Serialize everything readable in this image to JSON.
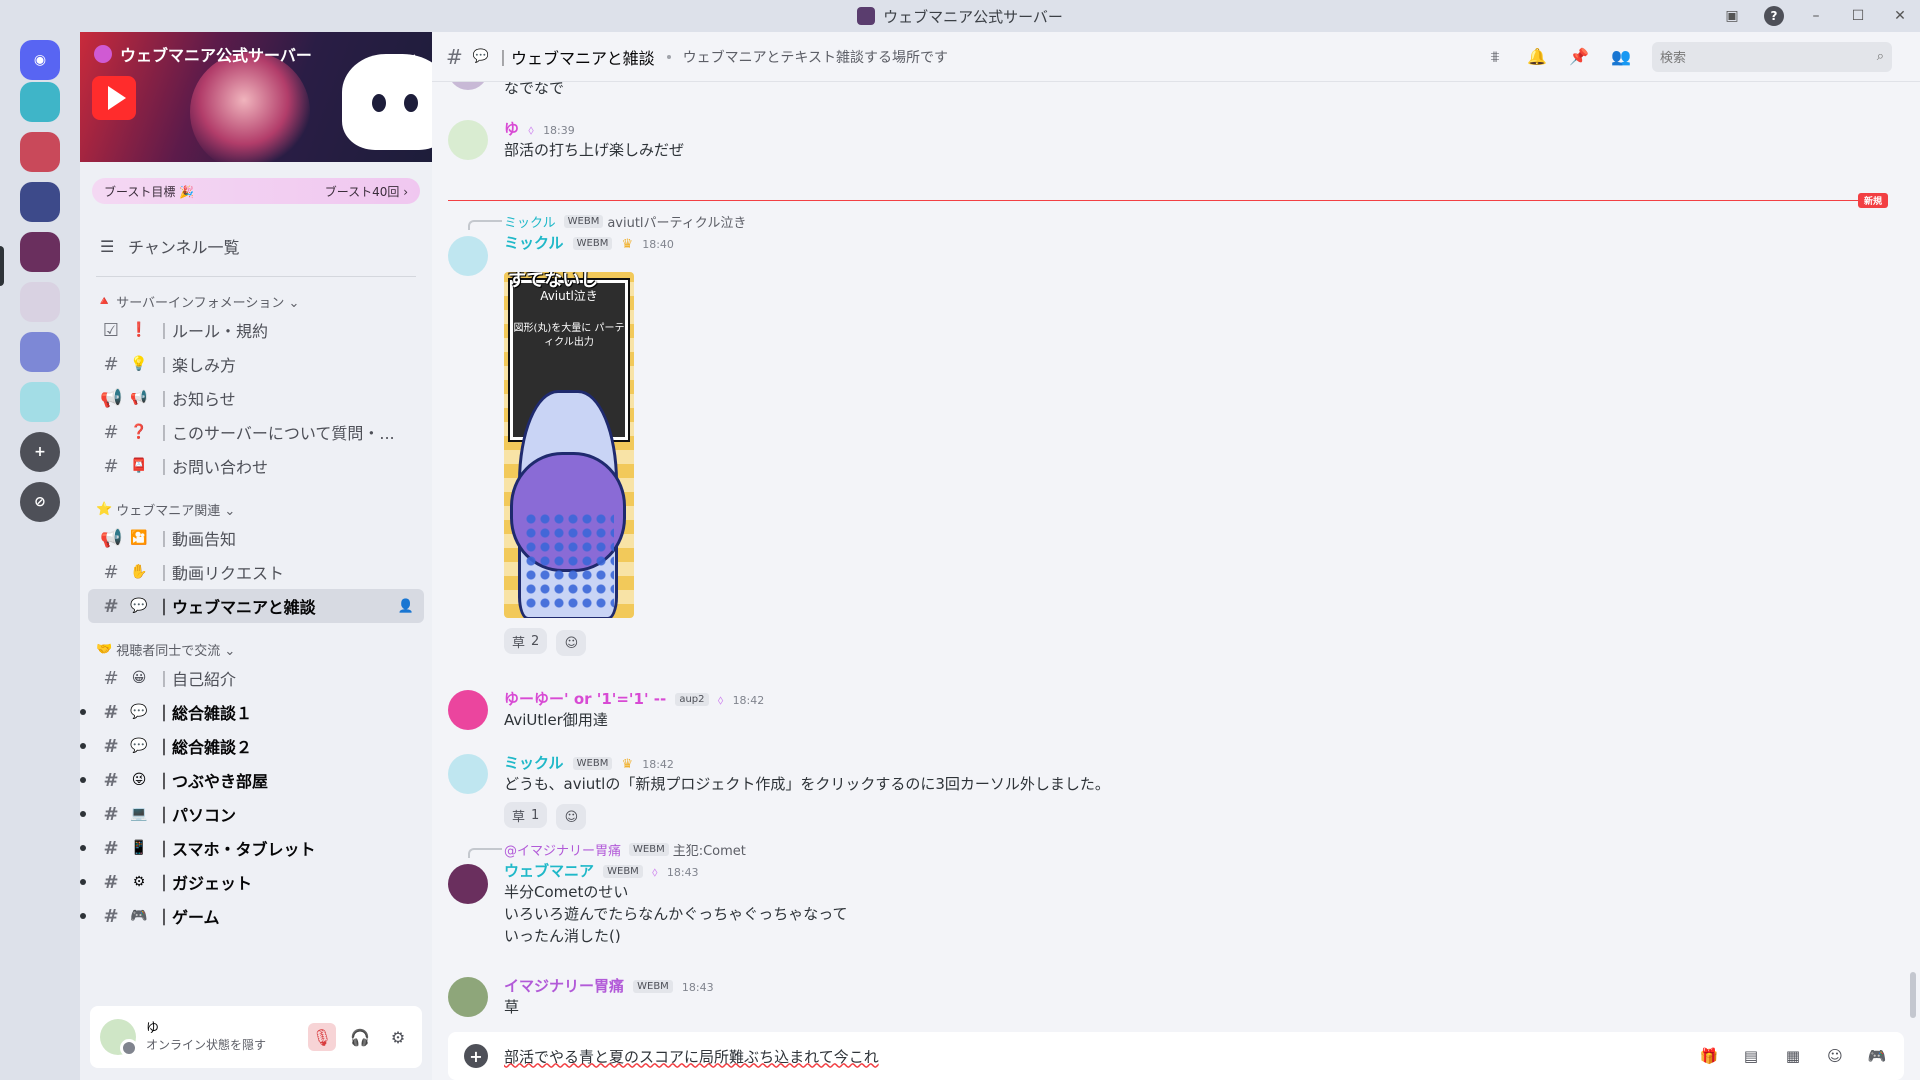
{
  "window": {
    "title": "ウェブマニア公式サーバー"
  },
  "server": {
    "name": "ウェブマニア公式サーバー",
    "boost_goal": "ブースト目標 🎉",
    "boost_count": "ブースト40回 ›"
  },
  "sidebar": {
    "channel_list_label": "チャンネル一覧",
    "categories": [
      {
        "label": "サーバーインフォメーション ⌄",
        "emoji": "🔺",
        "channels": [
          {
            "icon": "☑",
            "emoji": "❗",
            "label": "｜ルール・規約"
          },
          {
            "icon": "#",
            "emoji": "💡",
            "label": "｜楽しみ方"
          },
          {
            "icon": "📢",
            "emoji": "📢",
            "label": "｜お知らせ"
          },
          {
            "icon": "#",
            "emoji": "❓",
            "label": "｜このサーバーについて質問・..."
          },
          {
            "icon": "#",
            "emoji": "📮",
            "label": "｜お問い合わせ"
          }
        ]
      },
      {
        "label": "ウェブマニア関連 ⌄",
        "emoji": "⭐",
        "channels": [
          {
            "icon": "📢",
            "emoji": "🎦",
            "label": "｜動画告知"
          },
          {
            "icon": "#",
            "emoji": "✋",
            "label": "｜動画リクエスト"
          },
          {
            "icon": "#",
            "emoji": "💬",
            "label": "｜ウェブマニアと雑談"
          }
        ]
      },
      {
        "label": "視聴者同士で交流 ⌄",
        "emoji": "🤝",
        "channels": [
          {
            "icon": "#",
            "emoji": "😀",
            "label": "｜自己紹介"
          },
          {
            "icon": "#",
            "emoji": "💬",
            "label": "｜総合雑談１"
          },
          {
            "icon": "#",
            "emoji": "💬",
            "label": "｜総合雑談２"
          },
          {
            "icon": "#",
            "emoji": "😜",
            "label": "｜つぶやき部屋"
          },
          {
            "icon": "#",
            "emoji": "💻",
            "label": "｜パソコン"
          },
          {
            "icon": "#",
            "emoji": "📱",
            "label": "｜スマホ・タブレット"
          },
          {
            "icon": "#",
            "emoji": "⚙",
            "label": "｜ガジェット"
          },
          {
            "icon": "#",
            "emoji": "🎮",
            "label": "｜ゲーム"
          }
        ]
      }
    ]
  },
  "user": {
    "name": "ゆ",
    "status": "オンライン状態を隠す"
  },
  "channel": {
    "title": "｜ウェブマニアと雑談",
    "topic": "ウェブマニアとテキスト雑談する場所です",
    "search_placeholder": "検索"
  },
  "new_label": "新規",
  "messages": {
    "m0": {
      "text": "なでなで"
    },
    "m1": {
      "user": "ゆ",
      "time": "18:39",
      "text": "部活の打ち上げ楽しみだぜ"
    },
    "m2": {
      "reply_user": "ミックル",
      "reply_badge": "WEBM",
      "reply_text": "aviutlパーティクル泣き",
      "user": "ミックル",
      "badge": "WEBM",
      "time": "18:40",
      "caption": "すてないし",
      "board_title": "Aviutl泣き",
      "board_text": "図形(丸)を大量に パーティクル出力",
      "reaction_emoji": "草",
      "reaction_count": "2"
    },
    "m3": {
      "user": "ゆーゆー' or '1'='1' --",
      "badge": "aup2",
      "time": "18:42",
      "text": "AviUtler御用達"
    },
    "m4": {
      "user": "ミックル",
      "badge": "WEBM",
      "time": "18:42",
      "text": "どうも、aviutlの「新規プロジェクト作成」をクリックするのに3回カーソル外しました。",
      "reaction_emoji": "草",
      "reaction_count": "1"
    },
    "m5": {
      "reply_user": "@イマジナリー胃痛",
      "reply_badge": "WEBM",
      "reply_text": "主犯:Comet",
      "user": "ウェブマニア",
      "badge": "WEBM",
      "time": "18:43",
      "line1": "半分Cometのせい",
      "line2": "いろいろ遊んでたらなんかぐっちゃぐっちゃなって",
      "line3": "いったん消した()"
    },
    "m6": {
      "user": "イマジナリー胃痛",
      "badge": "WEBM",
      "time": "18:43",
      "text": "草"
    }
  },
  "composer": {
    "text": "部活でやる青と夏のスコアに局所難ぶち込まれて今これ"
  },
  "colors": {
    "accent": "#5865f2",
    "mention_pink": "#d84ad4",
    "cyan_name": "#1fb8c8",
    "purple_name": "#b25ad8",
    "new_red": "#f23f43"
  }
}
